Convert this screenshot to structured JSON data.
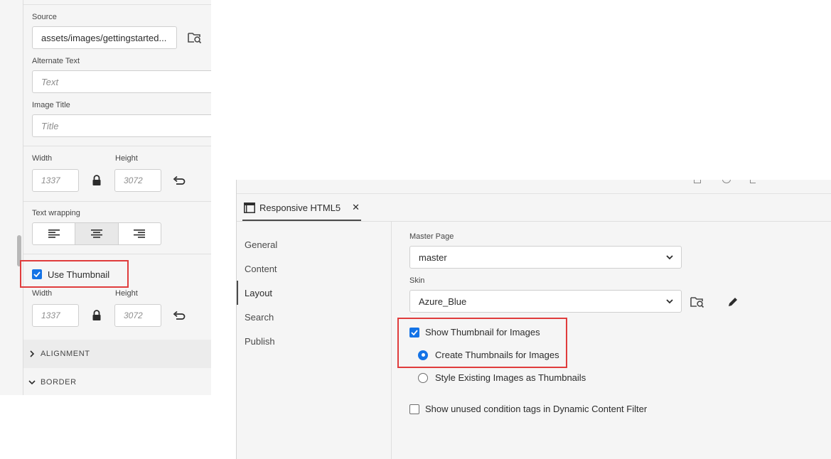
{
  "left_panel": {
    "source": {
      "label": "Source",
      "value": "assets/images/gettingstarted..."
    },
    "alt_text": {
      "label": "Alternate Text",
      "placeholder": "Text"
    },
    "image_title": {
      "label": "Image Title",
      "placeholder": "Title"
    },
    "size": {
      "width_label": "Width",
      "height_label": "Height",
      "width_placeholder": "1337",
      "height_placeholder": "3072"
    },
    "text_wrapping": {
      "label": "Text wrapping"
    },
    "use_thumbnail": {
      "label": "Use Thumbnail",
      "checked": true
    },
    "thumb_size": {
      "width_label": "Width",
      "height_label": "Height",
      "width_placeholder": "1337",
      "height_placeholder": "3072"
    },
    "sections": [
      {
        "label": "ALIGNMENT",
        "expanded": false
      },
      {
        "label": "BORDER",
        "expanded": true
      }
    ]
  },
  "dialog": {
    "tab": {
      "title": "Responsive HTML5",
      "close": "✕"
    },
    "nav": [
      {
        "label": "General",
        "active": false
      },
      {
        "label": "Content",
        "active": false
      },
      {
        "label": "Layout",
        "active": true
      },
      {
        "label": "Search",
        "active": false
      },
      {
        "label": "Publish",
        "active": false
      }
    ],
    "master_page": {
      "label": "Master Page",
      "value": "master"
    },
    "skin": {
      "label": "Skin",
      "value": "Azure_Blue"
    },
    "options": {
      "show_thumbnail": {
        "label": "Show Thumbnail for Images",
        "checked": true
      },
      "create_thumbnails": {
        "label": "Create Thumbnails for Images",
        "selected": true
      },
      "style_existing": {
        "label": "Style Existing Images as Thumbnails",
        "selected": false
      },
      "unused_tags": {
        "label": "Show unused condition tags in Dynamic Content Filter",
        "checked": false
      }
    }
  },
  "colors": {
    "accent": "#1473e6",
    "highlight": "#e03c3c",
    "panel_bg": "#f5f5f5"
  }
}
